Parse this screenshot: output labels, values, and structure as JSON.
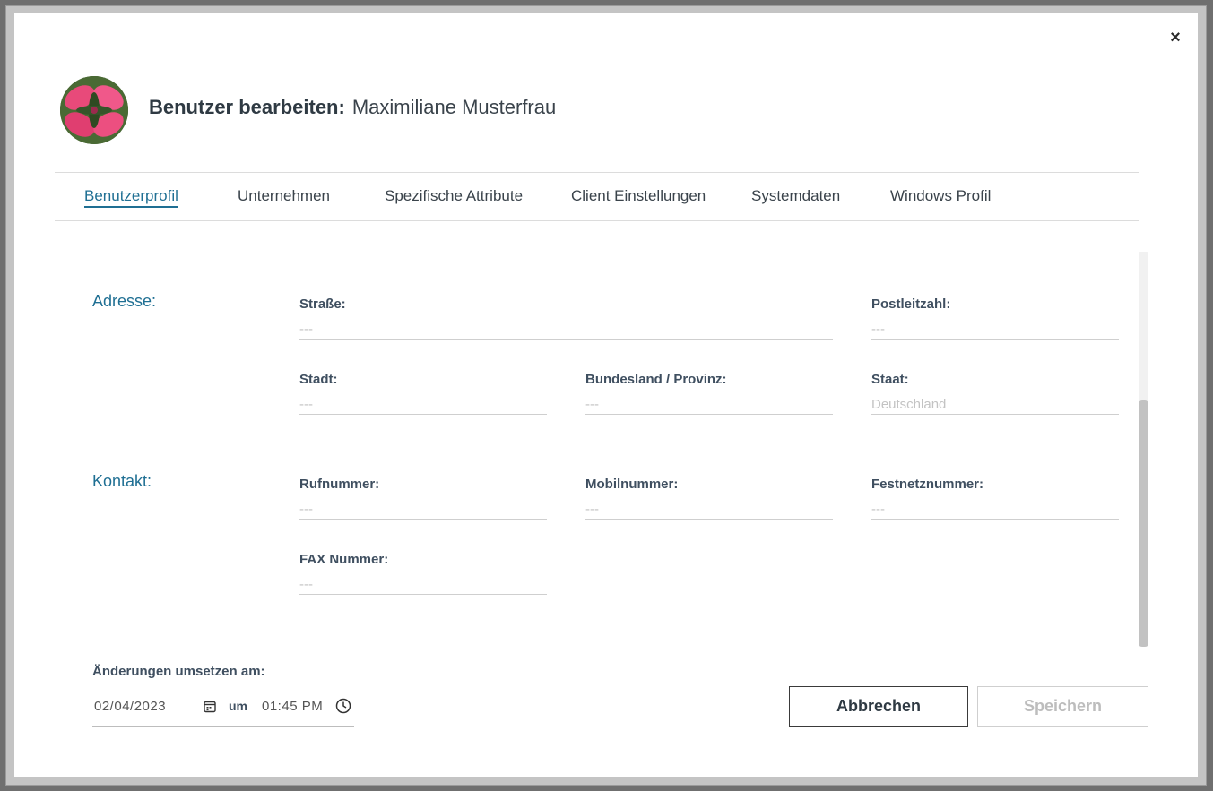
{
  "dialog": {
    "title_label": "Benutzer bearbeiten:",
    "user_name": "Maximiliane Musterfrau",
    "close_glyph": "×"
  },
  "tabs": [
    {
      "label": "Benutzerprofil",
      "active": true
    },
    {
      "label": "Unternehmen"
    },
    {
      "label": "Spezifische Attribute"
    },
    {
      "label": "Client Einstellungen"
    },
    {
      "label": "Systemdaten"
    },
    {
      "label": "Windows Profil"
    }
  ],
  "address": {
    "heading": "Adresse:",
    "street": {
      "label": "Straße:",
      "value": "---"
    },
    "postal_code": {
      "label": "Postleitzahl:",
      "value": "---"
    },
    "city": {
      "label": "Stadt:",
      "value": "---"
    },
    "state": {
      "label": "Bundesland / Provinz:",
      "value": "---"
    },
    "country": {
      "label": "Staat:",
      "value": "Deutschland"
    }
  },
  "contact": {
    "heading": "Kontakt:",
    "phone": {
      "label": "Rufnummer:",
      "value": "---"
    },
    "mobile": {
      "label": "Mobilnummer:",
      "value": "---"
    },
    "landline": {
      "label": "Festnetznummer:",
      "value": "---"
    },
    "fax": {
      "label": "FAX Nummer:",
      "value": "---"
    }
  },
  "apply": {
    "label": "Änderungen umsetzen am:",
    "date": "02/04/2023",
    "connector": "um",
    "time": "01:45 PM"
  },
  "buttons": {
    "cancel": "Abbrechen",
    "save": "Speichern"
  },
  "icons": {
    "close": "close-icon",
    "calendar": "calendar-icon",
    "clock": "clock-icon"
  },
  "colors": {
    "accent": "#1f6f93",
    "text": "#3f4f60",
    "placeholder": "#c3c3c3"
  }
}
